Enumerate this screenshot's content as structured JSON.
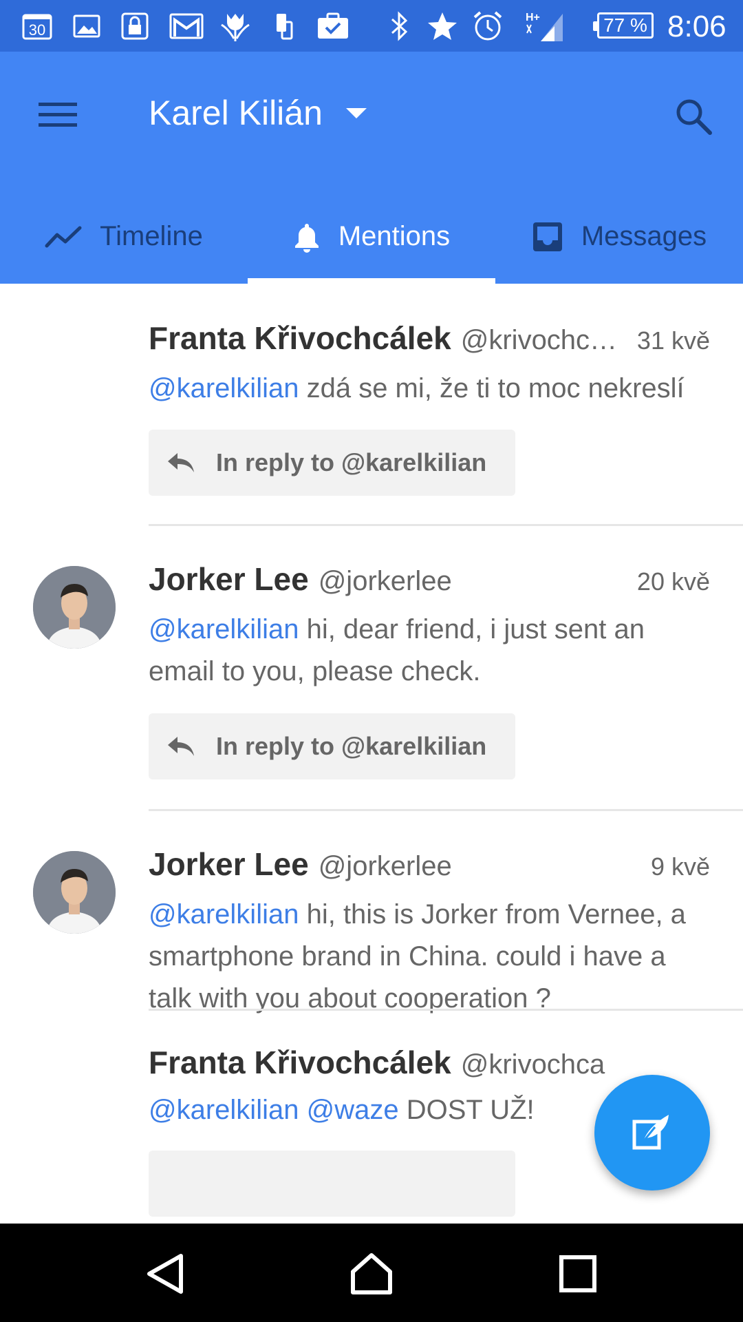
{
  "status_bar": {
    "battery": "77 %",
    "time": "8:06",
    "calendar_day": "30",
    "network": "H+"
  },
  "app_bar": {
    "account_name": "Karel Kilián",
    "menu_icon": "hamburger-menu-icon",
    "search_icon": "search-icon"
  },
  "tabs": [
    {
      "label": "Timeline",
      "icon": "trending-line-icon",
      "active": false
    },
    {
      "label": "Mentions",
      "icon": "bell-icon",
      "active": true
    },
    {
      "label": "Messages",
      "icon": "inbox-icon",
      "active": false
    }
  ],
  "posts": [
    {
      "author": "Franta Křivochcálek",
      "handle": "@krivochc…",
      "time": "31 kvě",
      "mention": "@karelkilian",
      "text": " zdá se mi, že ti to moc nekreslí",
      "reply": "In reply to @karelkilian"
    },
    {
      "author": "Jorker Lee",
      "handle": "@jorkerlee",
      "time": "20 kvě",
      "mention": "@karelkilian",
      "text": " hi, dear friend, i just sent an email to you, please check.",
      "reply": "In reply to @karelkilian"
    },
    {
      "author": "Jorker Lee",
      "handle": "@jorkerlee",
      "time": "9 kvě",
      "mention": "@karelkilian",
      "text": " hi, this is Jorker from Vernee, a smartphone brand in China. could i have a talk with you about cooperation ?"
    },
    {
      "author": "Franta Křivochcálek",
      "handle": "@krivochca",
      "mention": "@karelkilian",
      "mention2": "@waze",
      "text": " DOST UŽ!"
    }
  ],
  "fab": {
    "icon": "compose-feather-icon"
  },
  "nav_bar": {
    "back_icon": "back-triangle-icon",
    "home_icon": "home-icon",
    "recents_icon": "recents-square-icon"
  }
}
